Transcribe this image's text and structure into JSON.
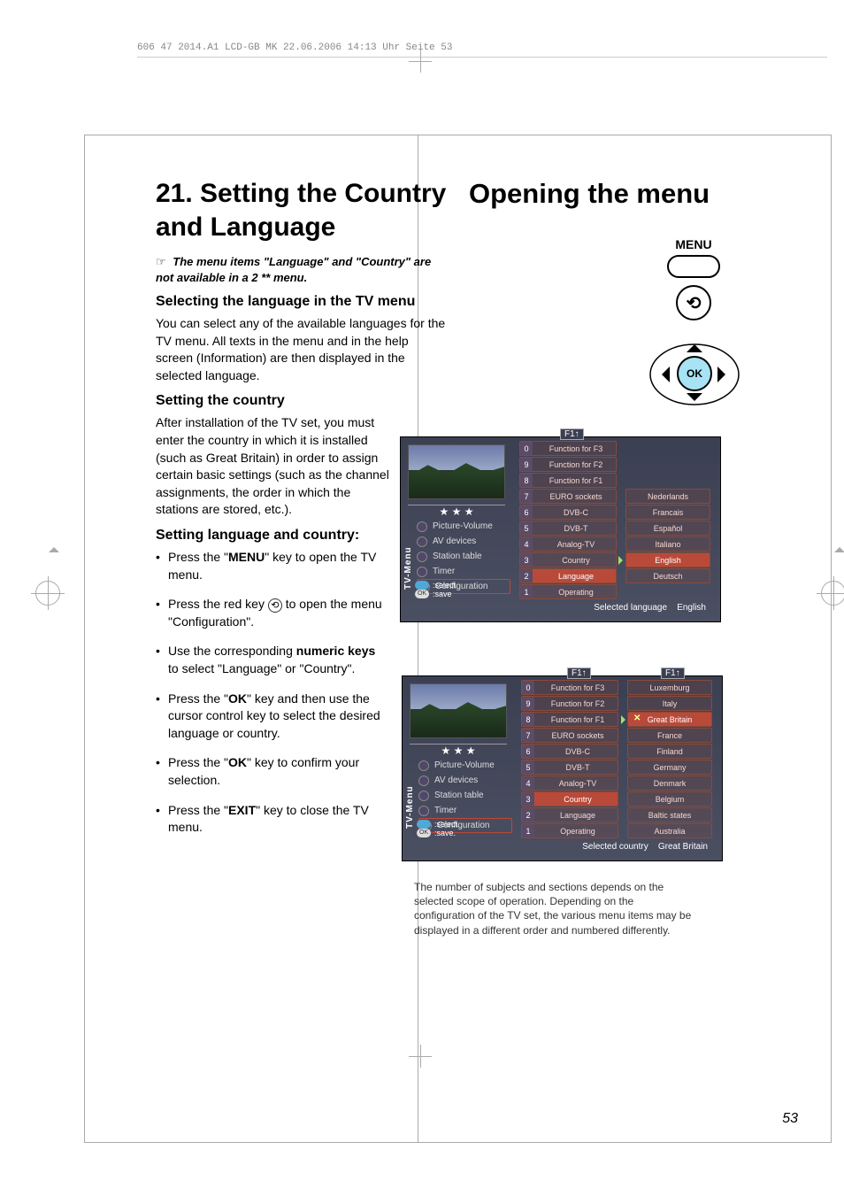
{
  "print_header": "606 47 2014.A1 LCD-GB MK  22.06.2006  14:13 Uhr  Seite 53",
  "left": {
    "h1": "21. Setting the Country and Language",
    "note": "The menu items \"Language\" and \"Country\" are not available in a 2 ** menu.",
    "h2a": "Selecting the language in the TV menu",
    "p1": "You can select any of the available languages for the TV menu. All texts in the menu and in the help screen (Information) are then displayed in the selected language.",
    "h2b": "Setting the country",
    "p2": "After installation of the TV set, you must enter the country in which it is installed (such as Great Britain) in order to assign certain basic settings (such as the channel assignments, the order in which the stations are stored, etc.).",
    "h2c": "Setting language and country:",
    "steps": {
      "s1a": "Press the \"",
      "s1b": "MENU",
      "s1c": "\" key to open the TV menu.",
      "s2": "Press the red key  ",
      "s2_icon": "⟲",
      "s2_tail": "  to open the menu \"Configuration\".",
      "s3a": "Use the corresponding ",
      "s3b": "numeric keys",
      "s3c": " to select \"Language\" or \"Country\".",
      "s4a": "Press the \"",
      "s4b": "OK",
      "s4c": "\" key and then use the cursor control key to select the desired language or country.",
      "s5a": "Press the \"",
      "s5b": "OK",
      "s5c": "\" key to confirm your selection.",
      "s6a": "Press the \"",
      "s6b": "EXIT",
      "s6c": "\" key to close the TV menu."
    }
  },
  "right": {
    "h1": "Opening the menu",
    "remote": {
      "menu": "MENU",
      "ok": "OK",
      "back": "⟲"
    }
  },
  "osd_common": {
    "f1": "F1↑",
    "stars": "★ ★ ★",
    "helpers_select": ":select",
    "helpers_save": ":save",
    "helpers_select2": ":select.",
    "helpers_save2": ":save.",
    "ok_chip": "OK",
    "tvmenu": "TV-Menu",
    "sidebar": [
      "Picture-Volume",
      "AV devices",
      "Station table",
      "Timer",
      "Configuration"
    ],
    "mid_items": [
      "Function for F3",
      "Function for F2",
      "Function for F1",
      "EURO sockets",
      "DVB-C",
      "DVB-T",
      "Analog-TV",
      "Country",
      "Language",
      "Operating"
    ],
    "mid_nums": [
      "0",
      "9",
      "8",
      "7",
      "6",
      "5",
      "4",
      "3",
      "2",
      "1"
    ]
  },
  "osd1": {
    "right_items": [
      "Nederlands",
      "Francais",
      "Español",
      "Italiano",
      "English",
      "Deutsch"
    ],
    "hot_right": "English",
    "hot_mid": "Language",
    "status_label": "Selected language",
    "status_value": "English"
  },
  "osd2": {
    "right_items": [
      "Luxemburg",
      "Italy",
      "Great Britain",
      "France",
      "Finland",
      "Germany",
      "Denmark",
      "Belgium",
      "Baltic states",
      "Australia"
    ],
    "hot_right": "Great Britain",
    "hot_mid": "Country",
    "status_label": "Selected country",
    "status_value": "Great Britain"
  },
  "footnote": "The number of subjects and sections depends on the selected scope of operation. Depending on the configuration of the TV set, the various menu items may be displayed in a different order and numbered differently.",
  "page_number": "53"
}
